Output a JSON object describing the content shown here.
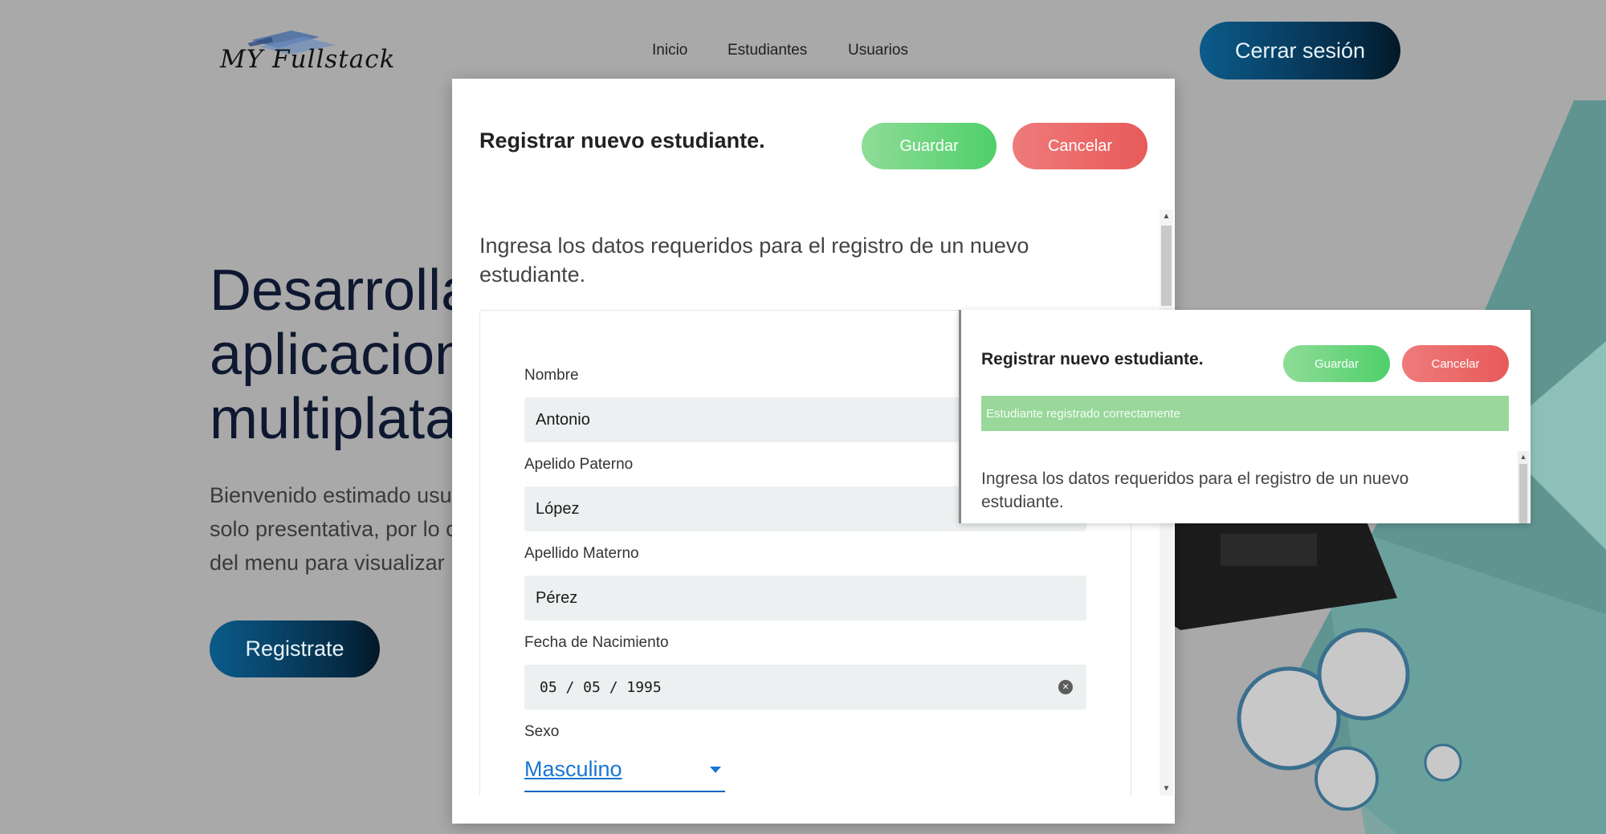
{
  "header": {
    "logo_text": "MY Fullstack",
    "nav": [
      "Inicio",
      "Estudiantes",
      "Usuarios"
    ],
    "logout_label": "Cerrar sesión"
  },
  "hero": {
    "title_lines": [
      "Desarrolla",
      "aplicacion",
      "multiplata"
    ],
    "subtitle_lines": [
      "Bienvenido estimado usu",
      "solo presentativa, por lo c",
      "del menu para visualizar"
    ],
    "register_label": "Registrate"
  },
  "modal": {
    "title": "Registrar nuevo estudiante.",
    "save_label": "Guardar",
    "cancel_label": "Cancelar",
    "description": "Ingresa los datos requeridos para el registro de un nuevo estudiante.",
    "fields": {
      "nombre": {
        "label": "Nombre",
        "value": "Antonio"
      },
      "apellido_paterno": {
        "label": "Apelido Paterno",
        "value": "López"
      },
      "apellido_materno": {
        "label": "Apellido Materno",
        "value": "Pérez"
      },
      "fecha_nacimiento": {
        "label": "Fecha de Nacimiento",
        "value": "05 / 05 / 1995"
      },
      "sexo": {
        "label": "Sexo",
        "value": "Masculino"
      }
    }
  },
  "panel2": {
    "title": "Registrar nuevo estudiante.",
    "save_label": "Guardar",
    "cancel_label": "Cancelar",
    "alert": "Estudiante registrado correctamente",
    "description": "Ingresa los datos requeridos para el registro de un nuevo estudiante."
  },
  "colors": {
    "accent_blue": "#0b5b8a",
    "save_green": "#4fd06a",
    "cancel_red": "#e85a5a",
    "alert_green": "#99d79b"
  }
}
